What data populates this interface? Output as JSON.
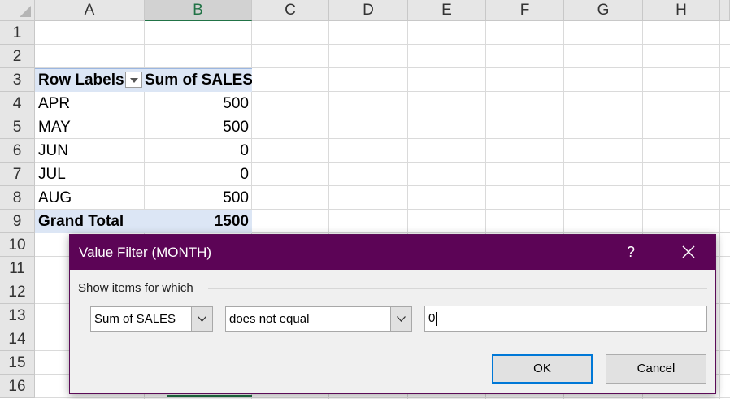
{
  "sheet": {
    "columns": [
      "A",
      "B",
      "C",
      "D",
      "E",
      "F",
      "G",
      "H"
    ],
    "selected_column": "B",
    "rows": [
      "1",
      "2",
      "3",
      "4",
      "5",
      "6",
      "7",
      "8",
      "9",
      "10",
      "11",
      "12",
      "13",
      "14",
      "15",
      "16"
    ]
  },
  "pivot": {
    "header": {
      "row_labels": "Row Labels",
      "sum_label": "Sum of SALES"
    },
    "rows": [
      {
        "label": "APR",
        "value": "500"
      },
      {
        "label": "MAY",
        "value": "500"
      },
      {
        "label": "JUN",
        "value": "0"
      },
      {
        "label": "JUL",
        "value": "0"
      },
      {
        "label": "AUG",
        "value": "500"
      }
    ],
    "total": {
      "label": "Grand Total",
      "value": "1500"
    },
    "band_color": "#dce6f5"
  },
  "dialog": {
    "title": "Value Filter (MONTH)",
    "help": "?",
    "group_label": "Show items for which",
    "field_select": {
      "value": "Sum of SALES"
    },
    "operator_select": {
      "value": "does not equal"
    },
    "value_input": {
      "value": "0"
    },
    "ok_label": "OK",
    "cancel_label": "Cancel",
    "title_color": "#5c0456"
  },
  "icons": {
    "dropdown": "chevron-down-icon",
    "close": "close-icon",
    "filter_dropdown": "filter-dropdown-icon",
    "select_all": "select-all-triangle-icon"
  }
}
